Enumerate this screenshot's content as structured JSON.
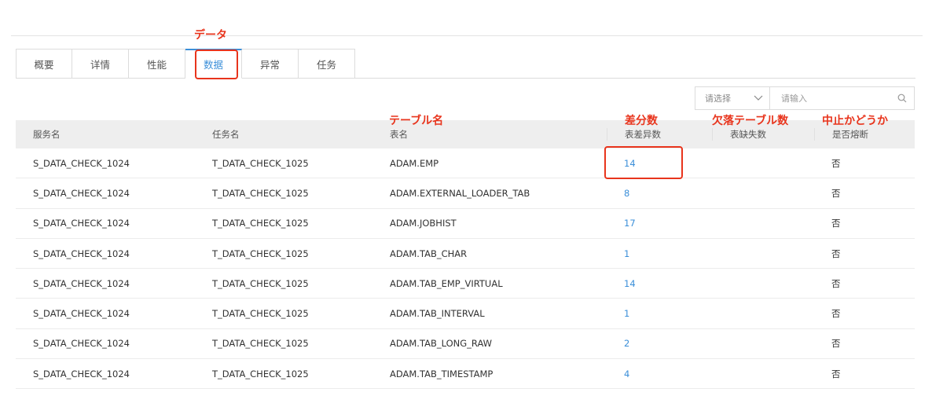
{
  "tabs": [
    {
      "label": "概要"
    },
    {
      "label": "详情"
    },
    {
      "label": "性能"
    },
    {
      "label": "数据",
      "active": true
    },
    {
      "label": "异常"
    },
    {
      "label": "任务"
    }
  ],
  "filter": {
    "select_placeholder": "请选择",
    "input_placeholder": "请输入"
  },
  "table": {
    "headers": [
      "服务名",
      "任务名",
      "表名",
      "表差异数",
      "表缺失数",
      "是否熔断"
    ],
    "rows": [
      {
        "service": "S_DATA_CHECK_1024",
        "task": "T_DATA_CHECK_1025",
        "table": "ADAM.EMP",
        "diff": "14",
        "missing": "",
        "fused": "否"
      },
      {
        "service": "S_DATA_CHECK_1024",
        "task": "T_DATA_CHECK_1025",
        "table": "ADAM.EXTERNAL_LOADER_TAB",
        "diff": "8",
        "missing": "",
        "fused": "否"
      },
      {
        "service": "S_DATA_CHECK_1024",
        "task": "T_DATA_CHECK_1025",
        "table": "ADAM.JOBHIST",
        "diff": "17",
        "missing": "",
        "fused": "否"
      },
      {
        "service": "S_DATA_CHECK_1024",
        "task": "T_DATA_CHECK_1025",
        "table": "ADAM.TAB_CHAR",
        "diff": "1",
        "missing": "",
        "fused": "否"
      },
      {
        "service": "S_DATA_CHECK_1024",
        "task": "T_DATA_CHECK_1025",
        "table": "ADAM.TAB_EMP_VIRTUAL",
        "diff": "14",
        "missing": "",
        "fused": "否"
      },
      {
        "service": "S_DATA_CHECK_1024",
        "task": "T_DATA_CHECK_1025",
        "table": "ADAM.TAB_INTERVAL",
        "diff": "1",
        "missing": "",
        "fused": "否"
      },
      {
        "service": "S_DATA_CHECK_1024",
        "task": "T_DATA_CHECK_1025",
        "table": "ADAM.TAB_LONG_RAW",
        "diff": "2",
        "missing": "",
        "fused": "否"
      },
      {
        "service": "S_DATA_CHECK_1024",
        "task": "T_DATA_CHECK_1025",
        "table": "ADAM.TAB_TIMESTAMP",
        "diff": "4",
        "missing": "",
        "fused": "否"
      }
    ]
  },
  "annotations": {
    "data_tab": "データ",
    "table_name": "テーブル名",
    "diff_count": "差分数",
    "missing_count": "欠落テーブル数",
    "fuse": "中止かどうか"
  },
  "colors": {
    "accent": "#3b8fd9",
    "annotation": "#e8341c"
  }
}
